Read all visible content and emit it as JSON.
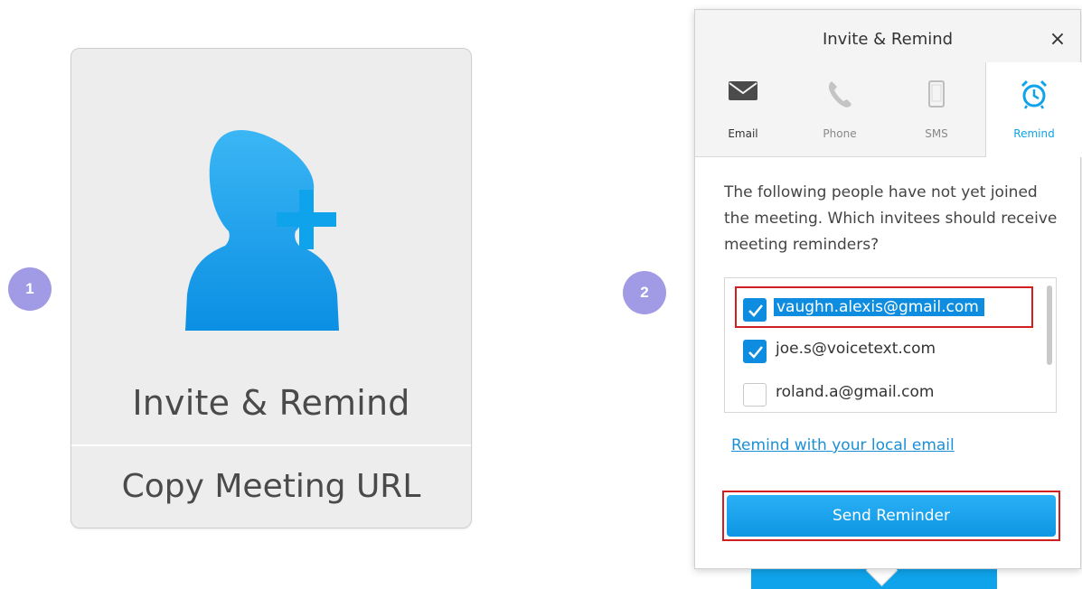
{
  "badges": {
    "step1": "1",
    "step2": "2"
  },
  "card": {
    "invite_label": "Invite & Remind",
    "copy_label": "Copy Meeting URL",
    "icon": "add-user-icon"
  },
  "popup": {
    "title": "Invite & Remind",
    "close": "×",
    "tabs": [
      {
        "label": "Email",
        "icon": "envelope-icon",
        "active": false
      },
      {
        "label": "Phone",
        "icon": "phone-icon",
        "active": false
      },
      {
        "label": "SMS",
        "icon": "mobile-icon",
        "active": false
      },
      {
        "label": "Remind",
        "icon": "alarm-clock-icon",
        "active": true
      }
    ],
    "prompt": "The following people have not yet joined the meeting. Which invitees should receive meeting reminders?",
    "invitees": [
      {
        "email": "vaughn.alexis@gmail.com",
        "checked": true
      },
      {
        "email": "joe.s@voicetext.com",
        "checked": true
      },
      {
        "email": "roland.a@gmail.com",
        "checked": false
      }
    ],
    "local_email_link": "Remind with your local email",
    "send_button": "Send Reminder"
  },
  "colors": {
    "accent": "#0ea3ea",
    "badge": "#a19be6",
    "highlight": "#d21e1e"
  }
}
